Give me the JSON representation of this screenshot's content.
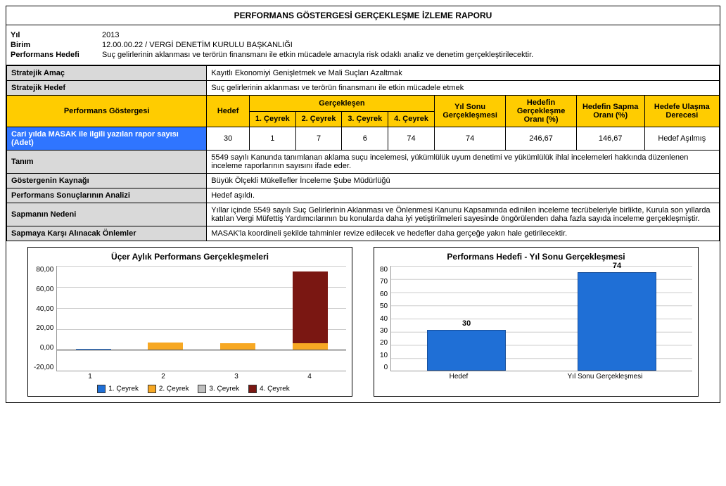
{
  "title": "PERFORMANS GÖSTERGESİ GERÇEKLEŞME İZLEME RAPORU",
  "header": {
    "year_label": "Yıl",
    "year_value": "2013",
    "unit_label": "Birim",
    "unit_value": "12.00.00.22 / VERGİ DENETİM KURULU BAŞKANLIĞI",
    "target_label": "Performans Hedefi",
    "target_value": "Suç gelirlerinin aklanması ve terörün finansmanı ile etkin mücadele amacıyla risk odaklı analiz ve denetim gerçekleştirilecektir."
  },
  "stratejik_amac_label": "Stratejik Amaç",
  "stratejik_amac_value": "Kayıtlı Ekonomiyi Genişletmek ve Mali Suçları Azaltmak",
  "stratejik_hedef_label": "Stratejik Hedef",
  "stratejik_hedef_value": "Suç gelirlerinin aklanması ve terörün finansmanı ile etkin mücadele etmek",
  "thead": {
    "indicator": "Performans Göstergesi",
    "hedef": "Hedef",
    "gerceklesen": "Gerçekleşen",
    "q1": "1. Çeyrek",
    "q2": "2. Çeyrek",
    "q3": "3. Çeyrek",
    "q4": "4. Çeyrek",
    "year_end": "Yıl Sonu Gerçekleşmesi",
    "ratio": "Hedefin Gerçekleşme Oranı (%)",
    "deviation": "Hedefin Sapma Oranı (%)",
    "degree": "Hedefe Ulaşma Derecesi"
  },
  "row": {
    "name": "Cari yılda MASAK ile ilgili yazılan rapor sayısı (Adet)",
    "hedef": "30",
    "q1": "1",
    "q2": "7",
    "q3": "6",
    "q4": "74",
    "year_end": "74",
    "ratio": "246,67",
    "deviation": "146,67",
    "degree": "Hedef Aşılmış"
  },
  "fields": {
    "tanim_label": "Tanım",
    "tanim_value": "5549 sayılı Kanunda tanımlanan aklama suçu incelemesi, yükümlülük uyum denetimi ve yükümlülük ihlal incelemeleri hakkında düzenlenen inceleme raporlarının sayısını ifade eder.",
    "kaynak_label": "Göstergenin Kaynağı",
    "kaynak_value": "Büyük Ölçekli Mükellefler İnceleme Şube Müdürlüğü",
    "analiz_label": "Performans Sonuçlarının Analizi",
    "analiz_value": "Hedef aşıldı.",
    "neden_label": "Sapmanın Nedeni",
    "neden_value": "Yıllar içinde 5549 sayılı Suç  Gelirlerinin Aklanması ve  Önlenmesi Kanunu Kapsamında edinilen inceleme tecrübeleriyle birlikte, Kurula son yıllarda katılan Vergi Müfettiş Yardımcılarının  bu konularda daha iyi yetiştirilmeleri sayesinde öngörülenden daha fazla sayıda inceleme gerçekleşmiştir.",
    "onlem_label": "Sapmaya Karşı Alınacak Önlemler",
    "onlem_value": "MASAK'la koordineli şekilde tahminler revize edilecek ve hedefler daha gerçeğe yakın hale getirilecektir."
  },
  "chart1": {
    "title": "Üçer Aylık Performans Gerçekleşmeleri",
    "yticks": [
      "80,00",
      "60,00",
      "40,00",
      "20,00",
      "0,00",
      "-20,00"
    ],
    "xlabels": [
      "1",
      "2",
      "3",
      "4"
    ],
    "legend": [
      "1. Çeyrek",
      "2. Çeyrek",
      "3. Çeyrek",
      "4. Çeyrek"
    ]
  },
  "chart2": {
    "title": "Performans Hedefi - Yıl Sonu Gerçekleşmesi",
    "yticks": [
      "80",
      "70",
      "60",
      "50",
      "40",
      "30",
      "20",
      "10",
      "0"
    ],
    "xlabels": [
      "Hedef",
      "Yıl Sonu Gerçekleşmesi"
    ],
    "labels": [
      "30",
      "74"
    ]
  },
  "chart_data": [
    {
      "type": "bar",
      "title": "Üçer Aylık Performans Gerçekleşmeleri",
      "categories": [
        "1",
        "2",
        "3",
        "4"
      ],
      "series": [
        {
          "name": "1. Çeyrek",
          "values": [
            1,
            0,
            0,
            0
          ]
        },
        {
          "name": "2. Çeyrek",
          "values": [
            0,
            7,
            0,
            0
          ]
        },
        {
          "name": "3. Çeyrek",
          "values": [
            0,
            0,
            6,
            0
          ]
        },
        {
          "name": "4. Çeyrek",
          "values": [
            0,
            0,
            0,
            74
          ]
        }
      ],
      "ylim": [
        -20,
        80
      ],
      "ylabel": "",
      "xlabel": ""
    },
    {
      "type": "bar",
      "title": "Performans Hedefi - Yıl Sonu Gerçekleşmesi",
      "categories": [
        "Hedef",
        "Yıl Sonu Gerçekleşmesi"
      ],
      "values": [
        30,
        74
      ],
      "ylim": [
        0,
        80
      ],
      "ylabel": "",
      "xlabel": ""
    }
  ]
}
